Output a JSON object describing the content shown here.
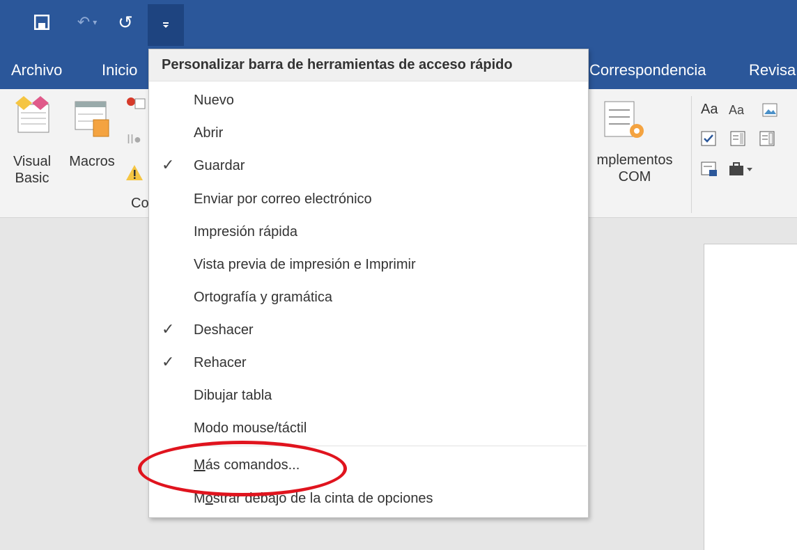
{
  "tabs": {
    "archivo": "Archivo",
    "inicio": "Inicio",
    "correspondencia": "Correspondencia",
    "revisar": "Revisa"
  },
  "ribbon": {
    "visual_basic_line1": "Visual",
    "visual_basic_line2": "Basic",
    "macros": "Macros",
    "group_label": "Co",
    "complementos_line1": "mplementos",
    "complementos_line2": "COM",
    "aa1": "Aa",
    "aa2": "Aa"
  },
  "menu": {
    "header": "Personalizar barra de herramientas de acceso rápido",
    "items": [
      {
        "label": "Nuevo",
        "checked": false
      },
      {
        "label": "Abrir",
        "checked": false
      },
      {
        "label": "Guardar",
        "checked": true
      },
      {
        "label": "Enviar por correo electrónico",
        "checked": false
      },
      {
        "label": "Impresión rápida",
        "checked": false
      },
      {
        "label": "Vista previa de impresión e Imprimir",
        "checked": false
      },
      {
        "label": "Ortografía y gramática",
        "checked": false
      },
      {
        "label": "Deshacer",
        "checked": true
      },
      {
        "label": "Rehacer",
        "checked": true
      },
      {
        "label": "Dibujar tabla",
        "checked": false
      },
      {
        "label": "Modo mouse/táctil",
        "checked": false
      }
    ],
    "more_commands": {
      "accel": "M",
      "rest": "ás comandos..."
    },
    "show_below": {
      "pre": "M",
      "accel": "o",
      "rest": "strar debajo de la cinta de opciones"
    },
    "check_mark": "✓"
  },
  "colors": {
    "title_bar": "#2b579a",
    "highlight_ellipse": "#e0141e"
  }
}
